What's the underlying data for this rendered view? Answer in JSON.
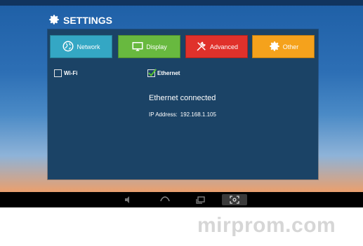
{
  "header": {
    "title": "SETTINGS",
    "icon": "gear-icon"
  },
  "tabs": [
    {
      "label": "Network",
      "icon": "globe-icon",
      "color": "#34a7c4"
    },
    {
      "label": "Display",
      "icon": "monitor-icon",
      "color": "#68b93f"
    },
    {
      "label": "Advanced",
      "icon": "tools-icon",
      "color": "#e0312b"
    },
    {
      "label": "Other",
      "icon": "gear-icon",
      "color": "#f5a21c"
    }
  ],
  "network": {
    "wifi": {
      "label": "Wi-Fi",
      "checked": false
    },
    "ethernet": {
      "label": "Ethernet",
      "checked": true
    },
    "status": "Ethernet connected",
    "ip_label": "IP Address:",
    "ip_value": "192.168.1.105"
  },
  "navbar": {
    "buttons": [
      "volume-icon",
      "home-icon",
      "recent-apps-icon",
      "screenshot-icon"
    ]
  },
  "watermark": "mirprom.com"
}
